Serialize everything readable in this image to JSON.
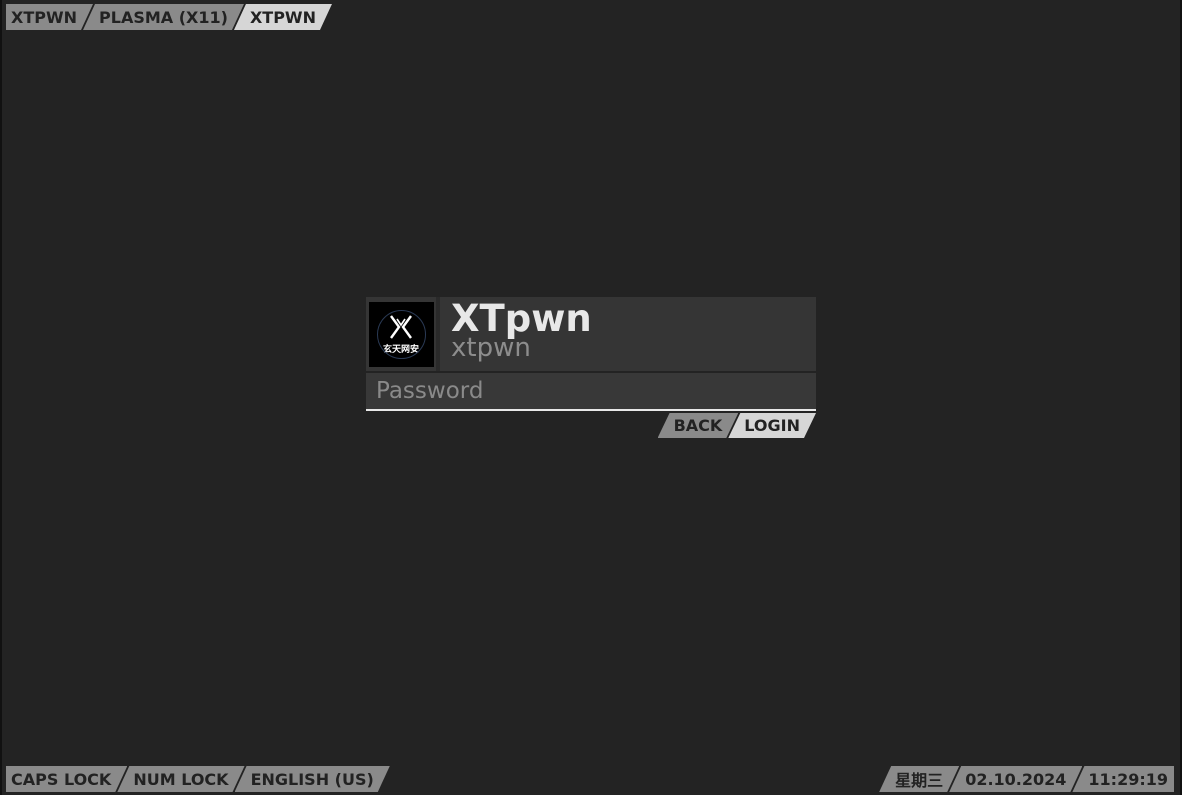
{
  "session_bar": {
    "items": [
      {
        "label": "XTPWN",
        "active": false
      },
      {
        "label": "PLASMA (X11)",
        "active": false
      },
      {
        "label": "XTPWN",
        "active": true
      }
    ]
  },
  "login": {
    "avatar_icon": "xuantian-logo-icon",
    "avatar_text": "玄天网安",
    "display_name": "XTpwn",
    "username": "xtpwn",
    "password_placeholder": "Password",
    "password_value": "",
    "back_label": "BACK",
    "login_label": "LOGIN"
  },
  "status_left": {
    "caps_lock": "CAPS LOCK",
    "num_lock": "NUM LOCK",
    "keyboard_layout": "ENGLISH (US)"
  },
  "status_right": {
    "weekday": "星期三",
    "date": "02.10.2024",
    "time": "11:29:19"
  },
  "colors": {
    "background": "#232323",
    "tab_inactive": "#8a8a8a",
    "tab_active": "#d6d6d6",
    "panel": "#353535"
  }
}
